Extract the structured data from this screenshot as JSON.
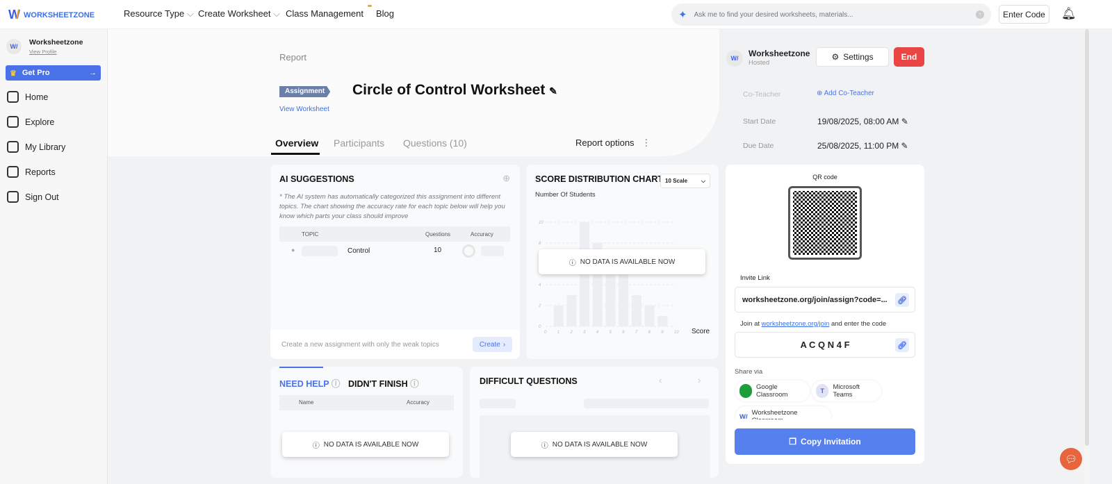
{
  "nav": {
    "brand": "WORKSHEETZONE",
    "items": [
      "Resource Type",
      "Create Worksheet",
      "Class Management",
      "Blog"
    ],
    "search_placeholder": "Ask me to find your desired worksheets, materials...",
    "enter_code": "Enter Code"
  },
  "sidebar": {
    "user": "Worksheetzone",
    "view_profile": "View Profile",
    "get_pro": "Get Pro",
    "items": [
      "Home",
      "Explore",
      "My Library",
      "Reports",
      "Sign Out"
    ]
  },
  "header": {
    "breadcrumb": "Report",
    "badge": "Assignment",
    "title": "Circle of Control Worksheet",
    "view_worksheet": "View Worksheet",
    "tabs": [
      "Overview",
      "Participants",
      "Questions (10)"
    ],
    "report_options": "Report options"
  },
  "host": {
    "name": "Worksheetzone",
    "role": "Hosted",
    "settings": "Settings",
    "end": "End",
    "co_teacher_label": "Co-Teacher",
    "add_co_teacher": "Add Co-Teacher",
    "start_label": "Start Date",
    "start": "19/08/2025, 08:00 AM",
    "due_label": "Due Date",
    "due": "25/08/2025, 11:00 PM"
  },
  "ai": {
    "title": "AI SUGGESTIONS",
    "desc": "* The AI system has automatically categorized this assignment into different topics. The chart showing the accuracy rate for each topic below will help you know which parts your class should improve",
    "cols": [
      "TOPIC",
      "Questions",
      "Accuracy"
    ],
    "row": {
      "topic": "Control",
      "questions": "10"
    },
    "footer": "Create a new assignment with only the weak topics",
    "create": "Create"
  },
  "score": {
    "scale": "10 Scale",
    "no_data": "NO DATA IS AVAILABLE NOW"
  },
  "chart_data": {
    "type": "bar",
    "title": "SCORE DISTRIBUTION CHART",
    "ylabel": "Number Of Students",
    "xlabel": "Score",
    "categories": [
      "0",
      "1",
      "2",
      "3",
      "4",
      "5",
      "6",
      "7",
      "8",
      "9",
      "10"
    ],
    "values": [
      0,
      2,
      3,
      10,
      8,
      6,
      6,
      3,
      2,
      1,
      0
    ],
    "yticks": [
      "0",
      "2",
      "4",
      "6",
      "8",
      "10"
    ],
    "ylim": [
      0,
      10
    ],
    "grid": true
  },
  "help": {
    "tabs": [
      "NEED HELP",
      "DIDN'T FINISH"
    ],
    "cols": [
      "Name",
      "Accuracy"
    ],
    "no_data": "NO DATA IS AVAILABLE NOW"
  },
  "difficult": {
    "title": "DIFFICULT QUESTIONS",
    "no_data": "NO DATA IS AVAILABLE NOW"
  },
  "invite": {
    "qr_label": "QR code",
    "invite_label": "Invite Link",
    "link": "worksheetzone.org/join/assign?code=...",
    "join_pre": "Join at",
    "join_link": "worksheetzone.org/join",
    "join_post": "and enter the code",
    "code": "A C Q N 4 F",
    "share_label": "Share via",
    "share": [
      "Google Classroom",
      "Microsoft Teams",
      "Worksheetzone Classroom"
    ],
    "copy": "Copy Invitation"
  }
}
